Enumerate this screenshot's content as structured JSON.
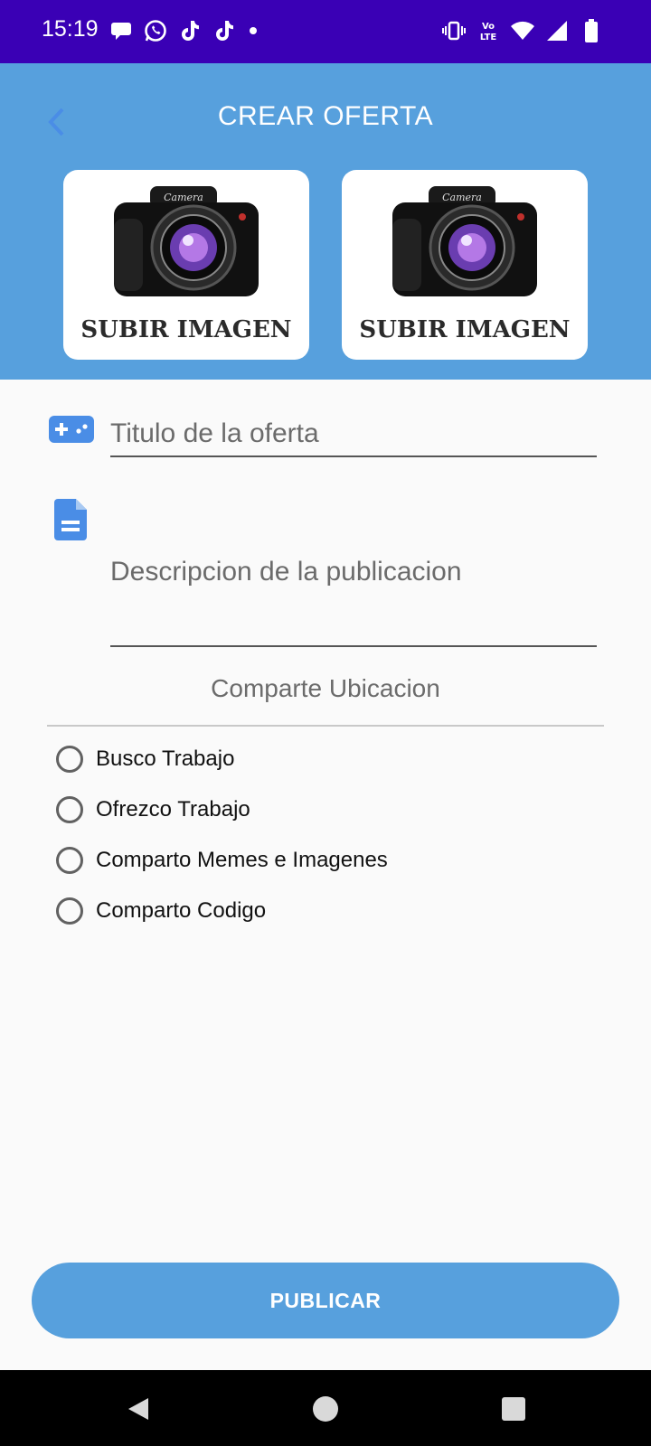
{
  "status_bar": {
    "time": "15:19",
    "left_icons": [
      "chat-bubble-icon",
      "whatsapp-icon",
      "tiktok-icon",
      "tiktok-icon",
      "dot-icon"
    ],
    "right_icons": [
      "vibrate-icon",
      "volte-icon",
      "wifi-icon",
      "signal-icon",
      "battery-icon"
    ],
    "volte_text": "Vo LTE"
  },
  "header": {
    "title": "CREAR OFERTA",
    "back_icon": "chevron-left-icon",
    "background": "#57a0dd"
  },
  "uploads": [
    {
      "label": "SUBIR IMAGEN",
      "icon": "camera-icon"
    },
    {
      "label": "SUBIR IMAGEN",
      "icon": "camera-icon"
    }
  ],
  "form": {
    "title_placeholder": "Titulo de la oferta",
    "title_icon": "gamepad-icon",
    "description_placeholder": "Descripcion de la publicacion",
    "description_icon": "document-icon",
    "share_location": "Comparte Ubicacion"
  },
  "options": [
    {
      "label": "Busco Trabajo",
      "selected": false
    },
    {
      "label": "Ofrezco Trabajo",
      "selected": false
    },
    {
      "label": "Comparto Memes e Imagenes",
      "selected": false
    },
    {
      "label": "Comparto Codigo",
      "selected": false
    }
  ],
  "publish_label": "PUBLICAR",
  "colors": {
    "status_bar": "#3a00b5",
    "accent": "#57a0dd",
    "icon_blue": "#4a8de6"
  }
}
